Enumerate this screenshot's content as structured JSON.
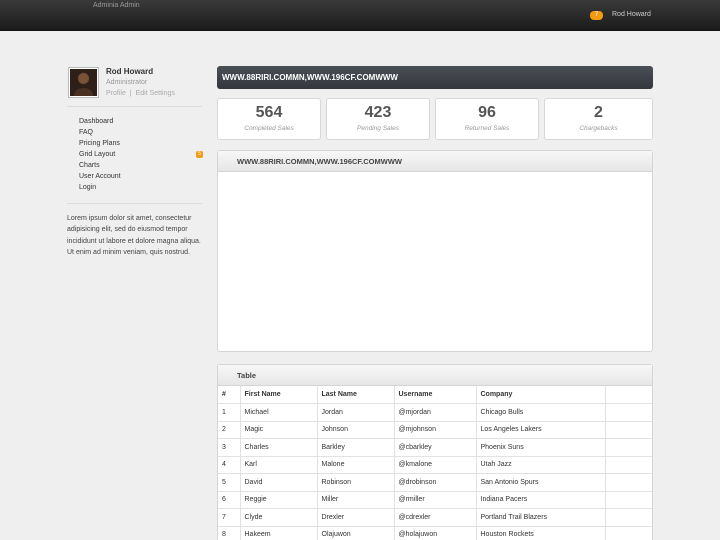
{
  "topbar": {
    "brand": "Adminia Admin",
    "notification_count": "7",
    "user": "Rod Howard"
  },
  "profile": {
    "name": "Rod Howard",
    "role": "Administrator",
    "link_profile": "Profile",
    "link_separator": "|",
    "link_edit": "Edit Settings"
  },
  "nav": [
    {
      "label": "Dashboard"
    },
    {
      "label": "FAQ"
    },
    {
      "label": "Pricing Plans"
    },
    {
      "label": "Grid Layout",
      "badge": "5"
    },
    {
      "label": "Charts"
    },
    {
      "label": "User Account"
    },
    {
      "label": "Login"
    }
  ],
  "sidebar_text": "Lorem ipsum dolor sit amet, consectetur adipisicing elit, sed do eiusmod tempor incididunt ut labore et dolore magna aliqua. Ut enim ad minim veniam, quis nostrud.",
  "url_bar": "WWW.88RIRI.COMMN,WWW.196CF.COMWWW",
  "stats": [
    {
      "value": "564",
      "label": "Completed Sales"
    },
    {
      "value": "423",
      "label": "Pending Sales"
    },
    {
      "value": "96",
      "label": "Returned Sales"
    },
    {
      "value": "2",
      "label": "Chargebacks"
    }
  ],
  "panel1": {
    "title": "WWW.88RIRI.COMMN,WWW.196CF.COMWWW"
  },
  "table": {
    "title": "Table",
    "headers": [
      "#",
      "First Name",
      "Last Name",
      "Username",
      "Company",
      ""
    ],
    "rows": [
      [
        "1",
        "Michael",
        "Jordan",
        "@mjordan",
        "Chicago Bulls",
        ""
      ],
      [
        "2",
        "Magic",
        "Johnson",
        "@mjohnson",
        "Los Angeles Lakers",
        ""
      ],
      [
        "3",
        "Charles",
        "Barkley",
        "@cbarkley",
        "Phoenix Suns",
        ""
      ],
      [
        "4",
        "Karl",
        "Malone",
        "@kmalone",
        "Utah Jazz",
        ""
      ],
      [
        "5",
        "David",
        "Robinson",
        "@drobinson",
        "San Antonio Spurs",
        ""
      ],
      [
        "6",
        "Reggie",
        "Miller",
        "@rmiller",
        "Indiana Pacers",
        ""
      ],
      [
        "7",
        "Clyde",
        "Drexler",
        "@cdrexler",
        "Portland Trail Blazers",
        ""
      ],
      [
        "8",
        "Hakeem",
        "Olajuwon",
        "@holajuwon",
        "Houston Rockets",
        ""
      ]
    ]
  },
  "colors": {
    "accent": "#f39c12",
    "topbar": "#2a2a2a",
    "url_bar": "#3f4348"
  }
}
